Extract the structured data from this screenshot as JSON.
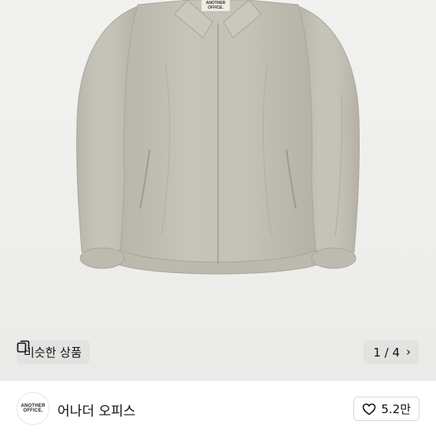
{
  "product_image": {
    "logo_lines": [
      "ANOTHER",
      "OFFICE."
    ],
    "similar_products_label": "비슷한 상품",
    "similar_icon": "similar-items-icon",
    "pager": {
      "text": "1 / 4",
      "current": 1,
      "total": 4,
      "next_icon": "chevron-right-icon"
    }
  },
  "seller": {
    "avatar_lines": [
      "ANOTHER",
      "OFFICE."
    ],
    "name": "어나더 오피스",
    "like_icon": "heart-outline-icon",
    "like_count": "5.2만"
  },
  "colors": {
    "jacket": "#c2bfb4",
    "background": "#efefed",
    "button_bg": "#e2e2e0"
  }
}
